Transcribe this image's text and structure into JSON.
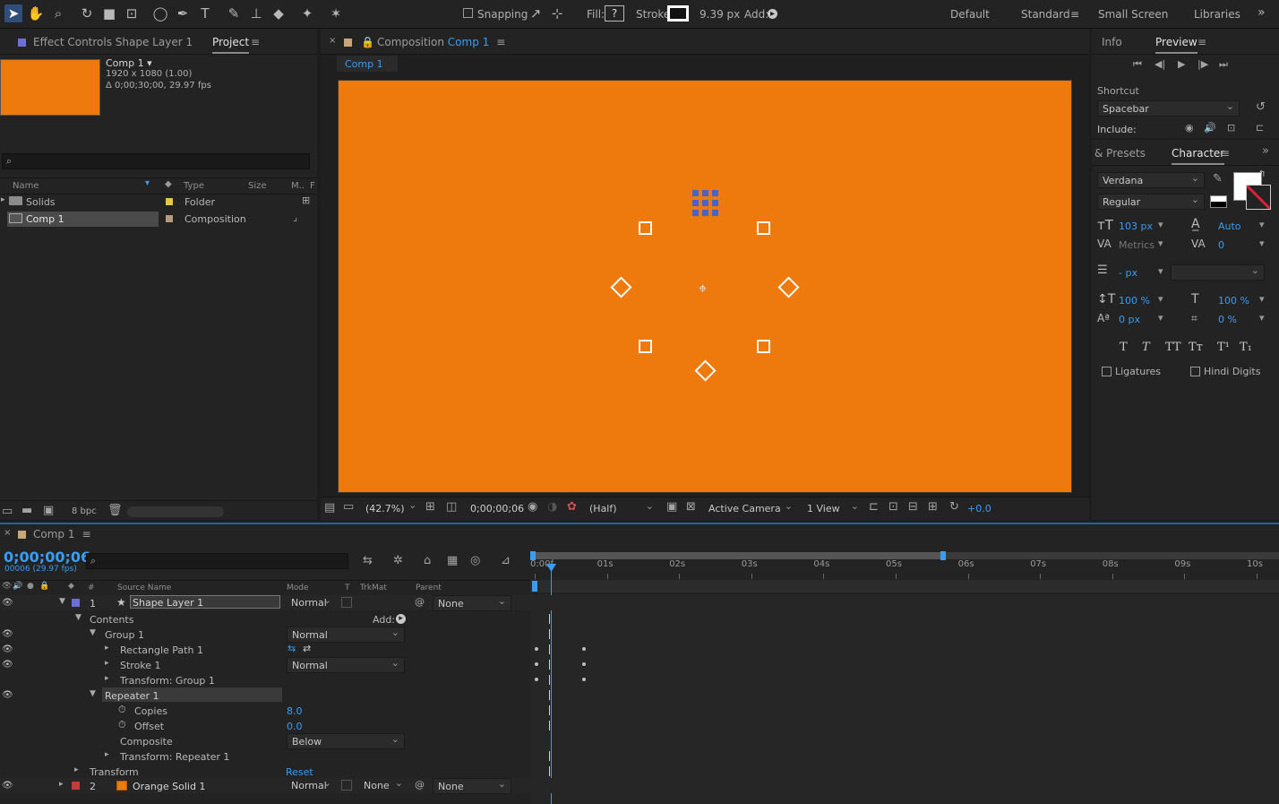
{
  "toolbar": {
    "snapping_label": "Snapping",
    "fill_label": "Fill:",
    "fill_value": "?",
    "stroke_label": "Stroke:",
    "stroke_width": "9.39 px",
    "add_label": "Add:",
    "workspaces": [
      "Default",
      "Standard",
      "Small Screen",
      "Libraries"
    ],
    "more": "»"
  },
  "project_panel": {
    "tab_effect_controls": "Effect Controls Shape Layer 1",
    "tab_project": "Project",
    "comp_name": "Comp 1 ▾",
    "comp_size": "1920 x 1080 (1.00)",
    "comp_duration": "Δ 0;00;30;00, 29.97 fps",
    "search_placeholder": "",
    "columns": [
      "Name",
      "Type",
      "Size",
      "M..",
      "F"
    ],
    "items": [
      {
        "name": "Solids",
        "type": "Folder"
      },
      {
        "name": "Comp 1",
        "type": "Composition"
      }
    ],
    "bpc": "8 bpc"
  },
  "composition_panel": {
    "tab_prefix": "Composition",
    "tab_comp": "Comp 1",
    "sub_tab": "Comp 1",
    "canvas_color": "#ee7a0d",
    "zoom": "(42.7%)",
    "timecode": "0;00;00;06",
    "resolution": "(Half)",
    "camera": "Active Camera",
    "view": "1 View",
    "exposure": "+0.0"
  },
  "preview_panel": {
    "tab_info": "Info",
    "tab_preview": "Preview",
    "shortcut_label": "Shortcut",
    "shortcut_value": "Spacebar",
    "include_label": "Include:"
  },
  "character_panel": {
    "tab_presets": "& Presets",
    "tab_character": "Character",
    "font": "Verdana",
    "style": "Regular",
    "size": "103 px",
    "leading": "Auto",
    "kerning": "Metrics",
    "tracking": "0",
    "stroke_px": "- px",
    "vscale": "100 %",
    "hscale": "100 %",
    "baseline": "0 px",
    "tsume": "0 %",
    "ligatures": "Ligatures",
    "hindi_digits": "Hindi Digits"
  },
  "timeline": {
    "tab": "Comp 1",
    "timecode": "0;00;00;06",
    "frames": "00006 (29.97 fps)",
    "col_source": "Source Name",
    "col_mode": "Mode",
    "col_t": "T",
    "col_trkmat": "TrkMat",
    "col_parent": "Parent",
    "col_num": "#",
    "ruler": [
      "0:00f",
      "01s",
      "02s",
      "03s",
      "04s",
      "05s",
      "06s",
      "07s",
      "08s",
      "09s",
      "10s"
    ],
    "layers": {
      "l1_num": "1",
      "l1_name": "Shape Layer 1",
      "l1_mode": "Normal",
      "l1_parent": "None",
      "contents": "Contents",
      "add": "Add:",
      "group1": "Group 1",
      "group1_mode": "Normal",
      "rect_path": "Rectangle Path 1",
      "stroke1": "Stroke 1",
      "stroke1_mode": "Normal",
      "transform_group": "Transform: Group 1",
      "repeater": "Repeater 1",
      "copies": "Copies",
      "copies_value": "8.0",
      "offset": "Offset",
      "offset_value": "0.0",
      "composite": "Composite",
      "composite_value": "Below",
      "transform_repeater": "Transform: Repeater 1",
      "transform": "Transform",
      "reset": "Reset",
      "l2_num": "2",
      "l2_name": "Orange Solid 1",
      "l2_mode": "Normal",
      "l2_trkmat": "None",
      "l2_parent": "None"
    }
  }
}
